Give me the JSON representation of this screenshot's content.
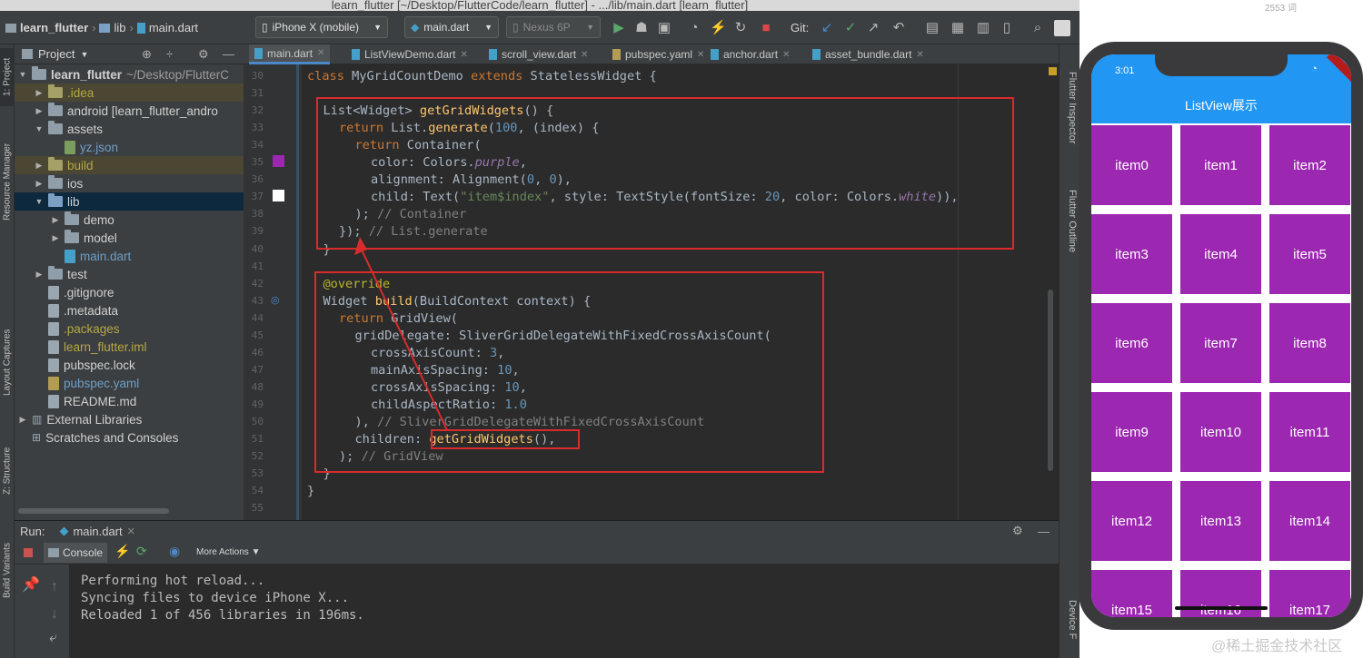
{
  "window": {
    "title": "learn_flutter [~/Desktop/FlutterCode/learn_flutter] - .../lib/main.dart [learn_flutter]",
    "corner_text": "2553 词"
  },
  "toolbar": {
    "breadcrumb": [
      "learn_flutter",
      "lib",
      "main.dart"
    ],
    "device_select": "iPhone X (mobile)",
    "run_config": "main.dart",
    "emulator_select": "Nexus 6P",
    "git_label": "Git:"
  },
  "left_strip": {
    "project": "1: Project",
    "resource_manager": "Resource Manager",
    "layout_captures": "Layout Captures",
    "structure": "Z: Structure",
    "build_variants": "Build Variants"
  },
  "project_panel": {
    "header": "Project",
    "tree": [
      {
        "label": "learn_flutter",
        "suffix": "~/Desktop/FlutterC",
        "depth": 0,
        "kind": "root",
        "open": true
      },
      {
        "label": ".idea",
        "depth": 1,
        "kind": "folder-excluded",
        "open": false
      },
      {
        "label": "android [learn_flutter_andro",
        "depth": 1,
        "kind": "folder",
        "open": false
      },
      {
        "label": "assets",
        "depth": 1,
        "kind": "folder",
        "open": true
      },
      {
        "label": "yz.json",
        "depth": 2,
        "kind": "json"
      },
      {
        "label": "build",
        "depth": 1,
        "kind": "folder-excluded",
        "open": false
      },
      {
        "label": "ios",
        "depth": 1,
        "kind": "folder",
        "open": false
      },
      {
        "label": "lib",
        "depth": 1,
        "kind": "folder-source",
        "open": true,
        "selected": true
      },
      {
        "label": "demo",
        "depth": 2,
        "kind": "folder",
        "open": false
      },
      {
        "label": "model",
        "depth": 2,
        "kind": "folder",
        "open": false
      },
      {
        "label": "main.dart",
        "depth": 2,
        "kind": "dart"
      },
      {
        "label": "test",
        "depth": 1,
        "kind": "folder-test",
        "open": false
      },
      {
        "label": ".gitignore",
        "depth": 1,
        "kind": "file"
      },
      {
        "label": ".metadata",
        "depth": 1,
        "kind": "file"
      },
      {
        "label": ".packages",
        "depth": 1,
        "kind": "file-excluded"
      },
      {
        "label": "learn_flutter.iml",
        "depth": 1,
        "kind": "file-excluded"
      },
      {
        "label": "pubspec.lock",
        "depth": 1,
        "kind": "file"
      },
      {
        "label": "pubspec.yaml",
        "depth": 1,
        "kind": "yaml"
      },
      {
        "label": "README.md",
        "depth": 1,
        "kind": "file"
      },
      {
        "label": "External Libraries",
        "depth": 0,
        "kind": "libs",
        "open": false
      },
      {
        "label": "Scratches and Consoles",
        "depth": 0,
        "kind": "scratch"
      }
    ]
  },
  "editor": {
    "tabs": [
      {
        "label": "main.dart",
        "active": true
      },
      {
        "label": "ListViewDemo.dart",
        "active": false
      },
      {
        "label": "scroll_view.dart",
        "active": false
      },
      {
        "label": "pubspec.yaml",
        "active": false
      },
      {
        "label": "anchor.dart",
        "active": false
      },
      {
        "label": "asset_bundle.dart",
        "active": false
      }
    ],
    "lines": [
      {
        "n": "30",
        "indent": 0,
        "tokens": [
          [
            "kw",
            "class "
          ],
          [
            "ty",
            "MyGridCountDemo "
          ],
          [
            "kw",
            "extends "
          ],
          [
            "ty",
            "StatelessWidget {"
          ]
        ]
      },
      {
        "n": "31",
        "indent": 0,
        "tokens": []
      },
      {
        "n": "32",
        "indent": 1,
        "tokens": [
          [
            "ty",
            "List<Widget> "
          ],
          [
            "fn",
            "getGridWidgets"
          ],
          [
            "ty",
            "() {"
          ]
        ]
      },
      {
        "n": "33",
        "indent": 2,
        "tokens": [
          [
            "kw",
            "return "
          ],
          [
            "ty",
            "List."
          ],
          [
            "fn",
            "generate"
          ],
          [
            "ty",
            "("
          ],
          [
            "num",
            "100"
          ],
          [
            "ty",
            ", (index) {"
          ]
        ]
      },
      {
        "n": "34",
        "indent": 3,
        "tokens": [
          [
            "kw",
            "return "
          ],
          [
            "ty",
            "Container("
          ]
        ]
      },
      {
        "n": "35",
        "indent": 4,
        "tokens": [
          [
            "ty",
            "color: Colors."
          ],
          [
            "pr",
            "purple"
          ],
          [
            "ty",
            ","
          ]
        ]
      },
      {
        "n": "36",
        "indent": 4,
        "tokens": [
          [
            "ty",
            "alignment: Alignment("
          ],
          [
            "num",
            "0"
          ],
          [
            "ty",
            ", "
          ],
          [
            "num",
            "0"
          ],
          [
            "ty",
            "),"
          ]
        ]
      },
      {
        "n": "37",
        "indent": 4,
        "tokens": [
          [
            "ty",
            "child: Text("
          ],
          [
            "str",
            "\"item$index\""
          ],
          [
            "ty",
            ", style: TextStyle(fontSize: "
          ],
          [
            "num",
            "20"
          ],
          [
            "ty",
            ", color: Colors."
          ],
          [
            "pr",
            "white"
          ],
          [
            "ty",
            ")),"
          ]
        ]
      },
      {
        "n": "38",
        "indent": 3,
        "tokens": [
          [
            "ty",
            "); "
          ],
          [
            "cm",
            "// Container"
          ]
        ]
      },
      {
        "n": "39",
        "indent": 2,
        "tokens": [
          [
            "ty",
            "}); "
          ],
          [
            "cm",
            "// List.generate"
          ]
        ]
      },
      {
        "n": "40",
        "indent": 1,
        "tokens": [
          [
            "ty",
            "}"
          ]
        ]
      },
      {
        "n": "41",
        "indent": 0,
        "tokens": []
      },
      {
        "n": "42",
        "indent": 1,
        "tokens": [
          [
            "an",
            "@override"
          ]
        ]
      },
      {
        "n": "43",
        "indent": 1,
        "tokens": [
          [
            "ty",
            "Widget "
          ],
          [
            "fn",
            "build"
          ],
          [
            "ty",
            "(BuildContext context) {"
          ]
        ]
      },
      {
        "n": "44",
        "indent": 2,
        "tokens": [
          [
            "kw",
            "return "
          ],
          [
            "ty",
            "GridView("
          ]
        ]
      },
      {
        "n": "45",
        "indent": 3,
        "tokens": [
          [
            "ty",
            "gridDelegate: SliverGridDelegateWithFixedCrossAxisCount("
          ]
        ]
      },
      {
        "n": "46",
        "indent": 4,
        "tokens": [
          [
            "ty",
            "crossAxisCount: "
          ],
          [
            "num",
            "3"
          ],
          [
            "ty",
            ","
          ]
        ]
      },
      {
        "n": "47",
        "indent": 4,
        "tokens": [
          [
            "ty",
            "mainAxisSpacing: "
          ],
          [
            "num",
            "10"
          ],
          [
            "ty",
            ","
          ]
        ]
      },
      {
        "n": "48",
        "indent": 4,
        "tokens": [
          [
            "ty",
            "crossAxisSpacing: "
          ],
          [
            "num",
            "10"
          ],
          [
            "ty",
            ","
          ]
        ]
      },
      {
        "n": "49",
        "indent": 4,
        "tokens": [
          [
            "ty",
            "childAspectRatio: "
          ],
          [
            "num",
            "1.0"
          ]
        ]
      },
      {
        "n": "50",
        "indent": 3,
        "tokens": [
          [
            "ty",
            "), "
          ],
          [
            "cm",
            "// SliverGridDelegateWithFixedCrossAxisCount"
          ]
        ]
      },
      {
        "n": "51",
        "indent": 3,
        "tokens": [
          [
            "ty",
            "children: "
          ],
          [
            "fn",
            "getGridWidgets"
          ],
          [
            "ty",
            "(),"
          ]
        ]
      },
      {
        "n": "52",
        "indent": 2,
        "tokens": [
          [
            "ty",
            "); "
          ],
          [
            "cm",
            "// GridView"
          ]
        ]
      },
      {
        "n": "53",
        "indent": 1,
        "tokens": [
          [
            "ty",
            "}"
          ]
        ]
      },
      {
        "n": "54",
        "indent": 0,
        "tokens": [
          [
            "ty",
            "}"
          ]
        ]
      },
      {
        "n": "55",
        "indent": 0,
        "tokens": []
      }
    ],
    "gutter_colors": {
      "purple": "#9c27b0",
      "white": "#ffffff"
    }
  },
  "run_panel": {
    "run_label": "Run:",
    "run_tab": "main.dart",
    "console_tab": "Console",
    "more_actions": "More Actions",
    "output": [
      "Performing hot reload...",
      "Syncing files to device iPhone X...",
      "Reloaded 1 of 456 libraries in 196ms."
    ]
  },
  "right_strip": {
    "inspector": "Flutter Inspector",
    "outline": "Flutter Outline",
    "device_file": "Device F"
  },
  "phone": {
    "time": "3:01",
    "appbar_title": "ListView展示",
    "items": [
      "item0",
      "item1",
      "item2",
      "item3",
      "item4",
      "item5",
      "item6",
      "item7",
      "item8",
      "item9",
      "item10",
      "item11",
      "item12",
      "item13",
      "item14",
      "item15",
      "item16",
      "item17"
    ],
    "colors": {
      "appbar": "#2196f3",
      "cell": "#9c27b0"
    }
  },
  "watermark": "@稀土掘金技术社区"
}
